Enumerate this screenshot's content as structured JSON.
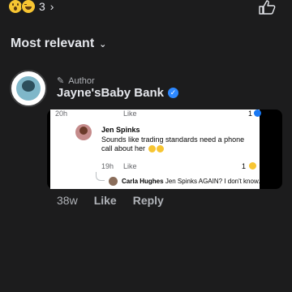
{
  "reactions": {
    "count": "3"
  },
  "sort": {
    "label": "Most relevant"
  },
  "comment": {
    "author_tag": "Author",
    "name": "Jayne'sBaby Bank",
    "embedded": {
      "top_time": "20h",
      "top_like": "Like",
      "top_count": "1",
      "jen_name": "Jen Spinks",
      "jen_text": "Sounds like trading standards need a phone call about her",
      "jen_time": "19h",
      "jen_like": "Like",
      "jen_count": "1",
      "carla_name": "Carla Hughes",
      "carla_text": "Jen Spinks AGAIN? I don't know..."
    },
    "age": "38w",
    "like_label": "Like",
    "reply_label": "Reply"
  },
  "colors": {
    "background": "#1c1c1d",
    "accent": "#2d88ff",
    "text": "#e4e6eb",
    "muted": "#b0b3b8"
  }
}
